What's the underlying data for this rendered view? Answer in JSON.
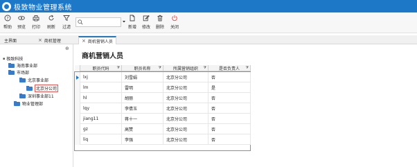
{
  "app": {
    "title": "极致物业管理系统"
  },
  "toolbar": {
    "help": "帮助",
    "preview": "预览",
    "print": "打印",
    "refresh": "刷新",
    "filter": "过滤",
    "add": "新增",
    "edit": "修改",
    "delete": "删除",
    "close": "关闭",
    "search_placeholder": ""
  },
  "tabs": [
    {
      "label": "主界面"
    },
    {
      "label": "商机管理"
    },
    {
      "label": "商机营销人员"
    }
  ],
  "tree": {
    "root": "极致科技",
    "items": [
      "海南事业部",
      "市场部",
      "北京事业部",
      "北京分公司",
      "深圳事业部11",
      "物业管理部"
    ]
  },
  "page": {
    "title": "商机营销人员"
  },
  "grid": {
    "columns": [
      "职员代码",
      "职员名称",
      "所属营销组织",
      "是否负责人"
    ],
    "rows": [
      [
        "lxj",
        "刘雪娟",
        "北京分公司",
        "否"
      ],
      [
        "lm",
        "雷明",
        "北京分公司",
        "是"
      ],
      [
        "hl",
        "胡丽",
        "北京分公司",
        "否"
      ],
      [
        "lqy",
        "李倩玉",
        "北京分公司",
        "否"
      ],
      [
        "jiang11",
        "蒋十一",
        "北京分公司",
        "否"
      ],
      [
        "gz",
        "高赞",
        "北京分公司",
        "否"
      ],
      [
        "liq",
        "李强",
        "北京分公司",
        "否"
      ]
    ]
  },
  "colors": {
    "titlebar": "#1e78c8",
    "highlight_border": "#e36a6a",
    "close_icon": "#e04848"
  }
}
